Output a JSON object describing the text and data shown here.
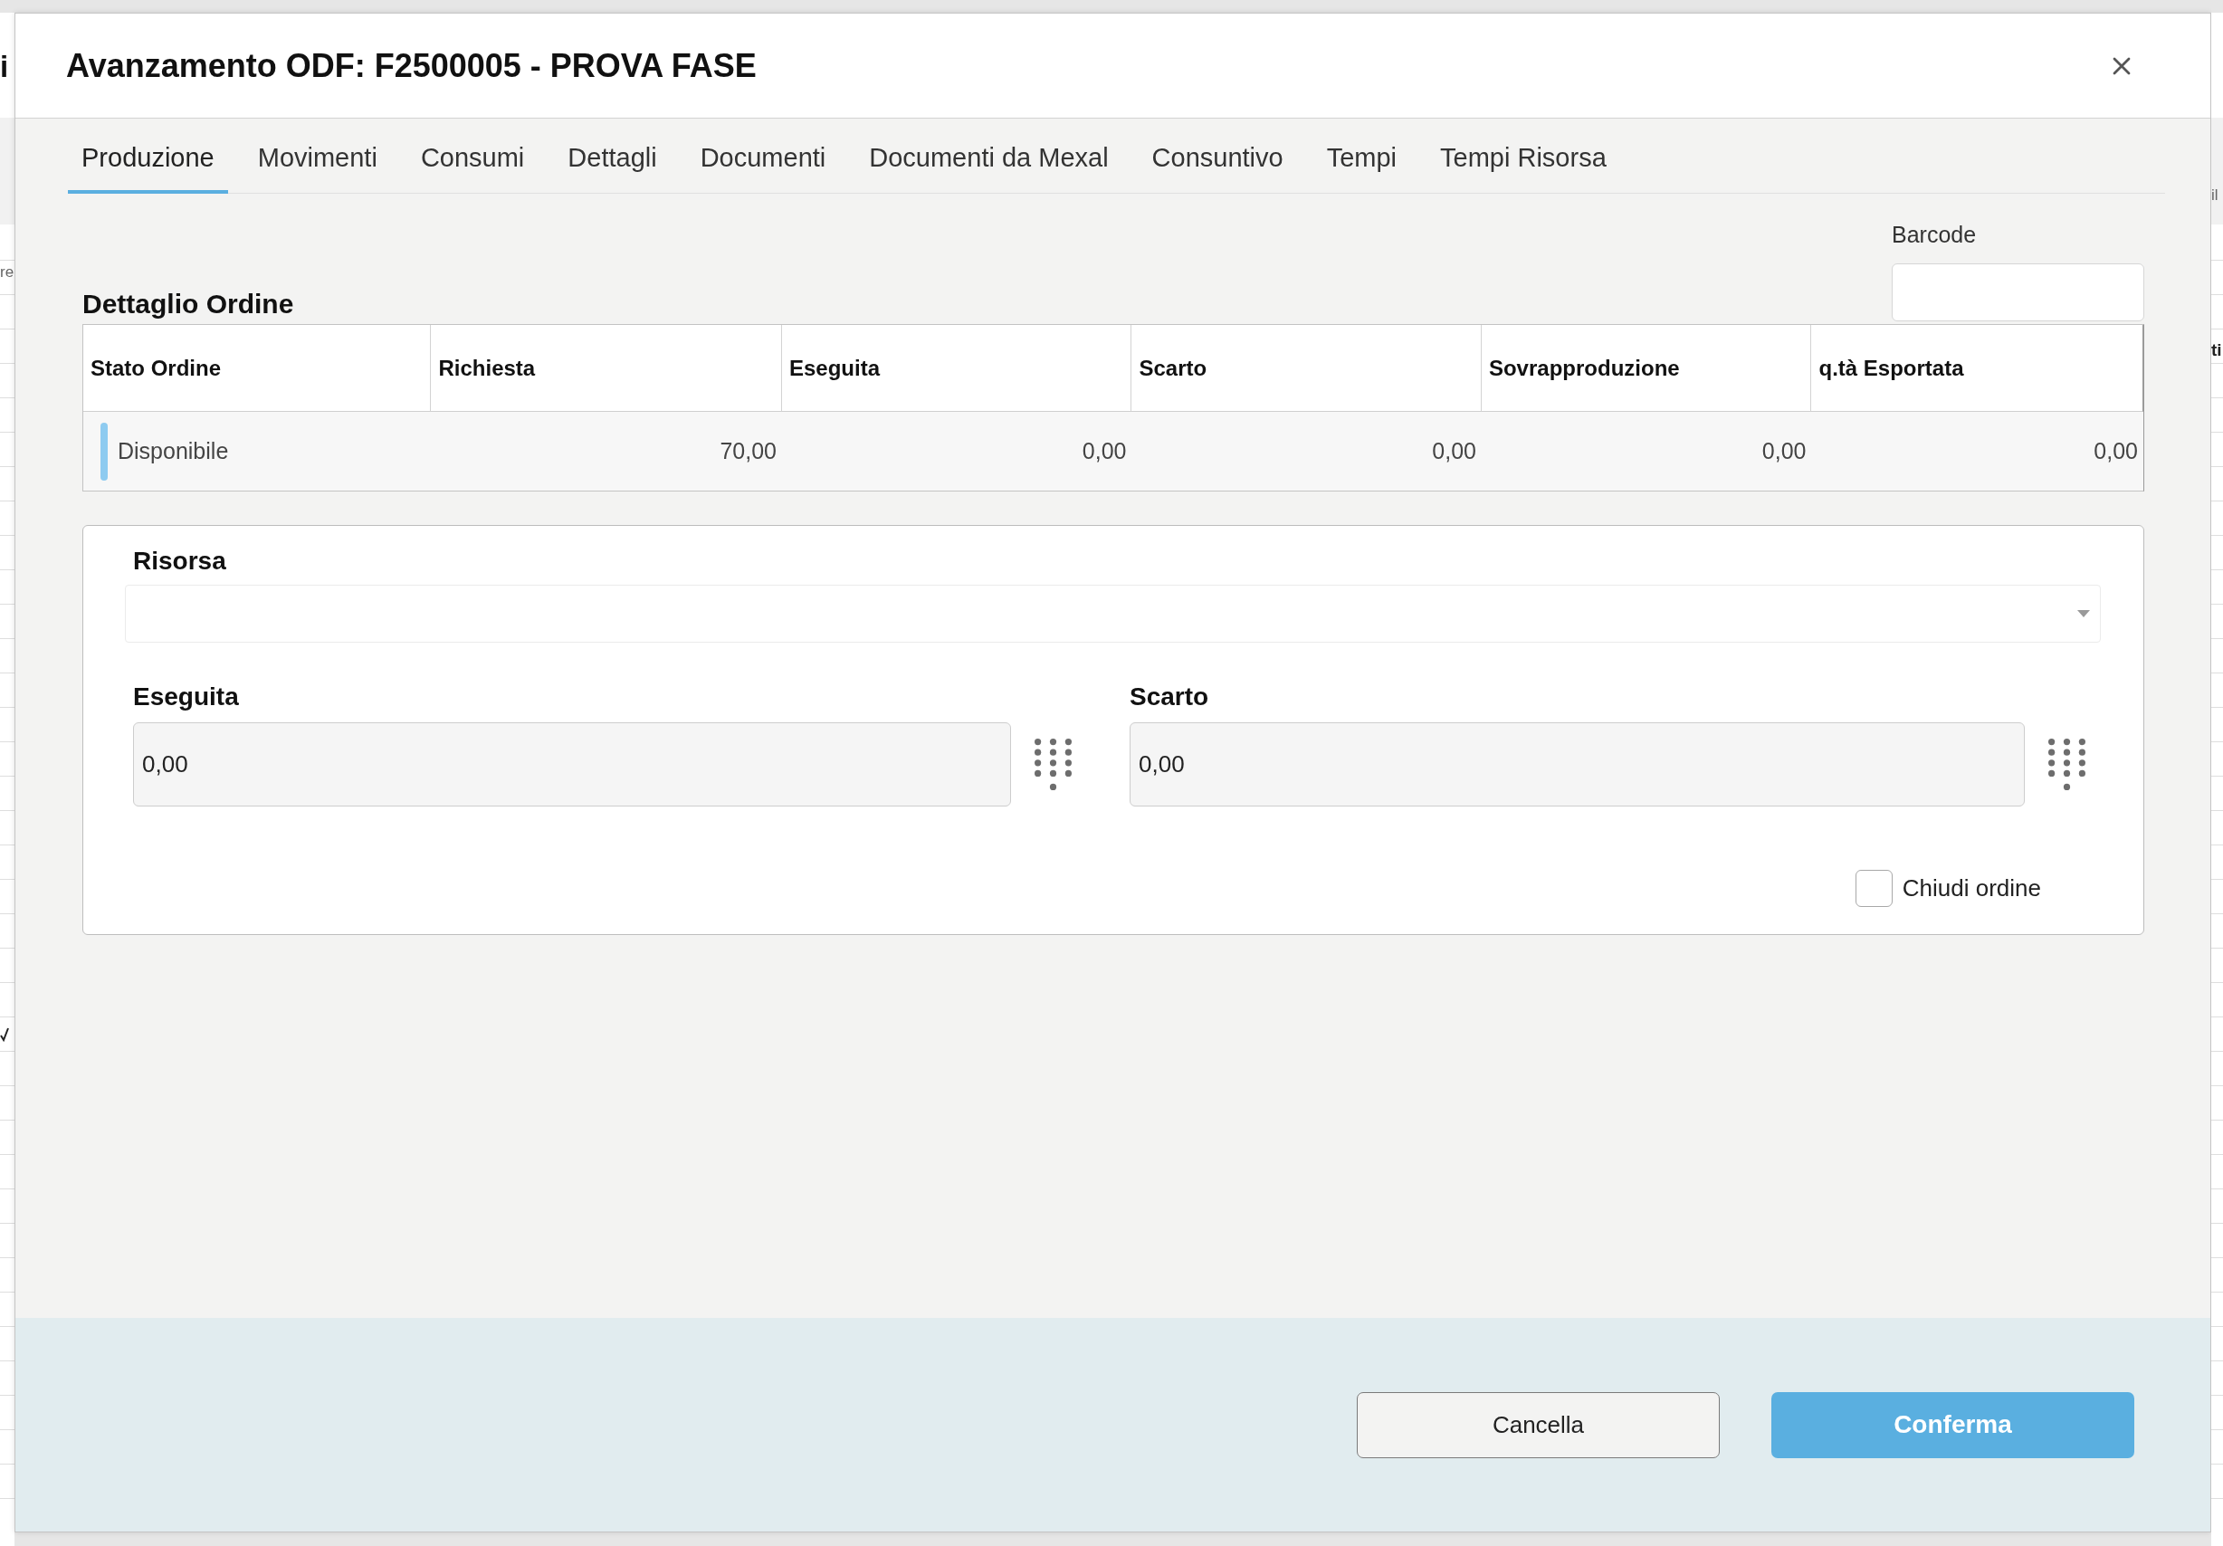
{
  "background": {
    "left_texts": [
      {
        "text": "i",
        "kind": "title"
      },
      {
        "text": "re",
        "kind": "plain"
      }
    ],
    "right_texts": [
      {
        "text": "il",
        "kind": "plain"
      },
      {
        "text": "ti",
        "kind": "bold"
      }
    ]
  },
  "dialog": {
    "title": "Avanzamento ODF: F2500005 - PROVA FASE",
    "tabs": [
      {
        "label": "Produzione",
        "selected": true
      },
      {
        "label": "Movimenti",
        "selected": false
      },
      {
        "label": "Consumi",
        "selected": false
      },
      {
        "label": "Dettagli",
        "selected": false
      },
      {
        "label": "Documenti",
        "selected": false
      },
      {
        "label": "Documenti da Mexal",
        "selected": false
      },
      {
        "label": "Consuntivo",
        "selected": false
      },
      {
        "label": "Tempi",
        "selected": false
      },
      {
        "label": "Tempi Risorsa",
        "selected": false
      }
    ],
    "barcode": {
      "label": "Barcode"
    },
    "order_detail": {
      "title": "Dettaglio Ordine",
      "columns": [
        "Stato Ordine",
        "Richiesta",
        "Eseguita",
        "Scarto",
        "Sovrapproduzione",
        "q.tà Esportata"
      ],
      "rows": [
        {
          "color": "#8ecbf0",
          "cells": [
            "Disponibile",
            "70,00",
            "0,00",
            "0,00",
            "0,00",
            "0,00"
          ]
        }
      ]
    },
    "form": {
      "resource": {
        "label": "Risorsa"
      },
      "fields": [
        {
          "label": "Eseguita",
          "value": "0,00"
        },
        {
          "label": "Scarto",
          "value": "0,00"
        }
      ],
      "close_order": {
        "label": "Chiudi ordine",
        "checked": false
      }
    },
    "buttons": [
      {
        "label": "Cancella",
        "kind": "secondary"
      },
      {
        "label": "Conferma",
        "kind": "primary"
      }
    ]
  }
}
